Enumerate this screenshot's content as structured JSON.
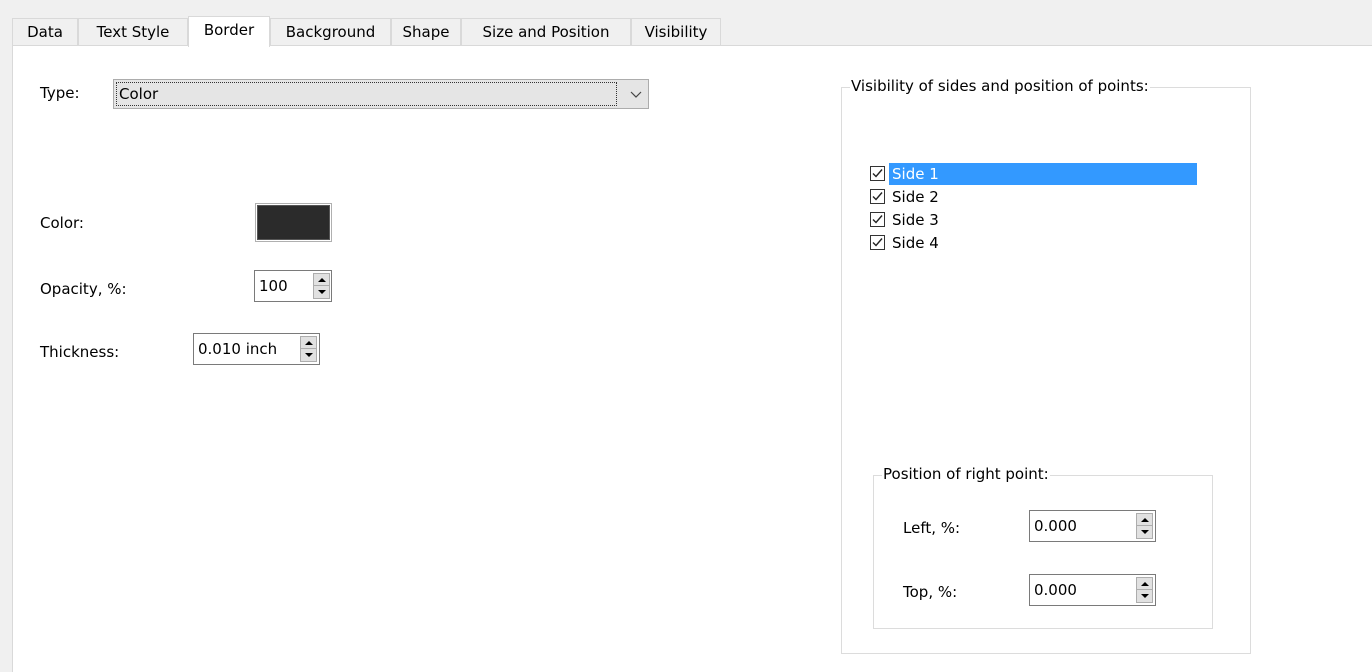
{
  "tabs": [
    {
      "label": "Data",
      "active": false
    },
    {
      "label": "Text Style",
      "active": false
    },
    {
      "label": "Border",
      "active": true
    },
    {
      "label": "Background",
      "active": false
    },
    {
      "label": "Shape",
      "active": false
    },
    {
      "label": "Size and Position",
      "active": false
    },
    {
      "label": "Visibility",
      "active": false
    }
  ],
  "border": {
    "type_label": "Type:",
    "type_value": "Color",
    "color_label": "Color:",
    "color_value": "#2b2b2b",
    "opacity_label": "Opacity, %:",
    "opacity_value": "100",
    "thickness_label": "Thickness:",
    "thickness_value": "0.010 inch"
  },
  "sides_group": {
    "title": "Visibility of sides and position of points:",
    "items": [
      {
        "label": "Side 1",
        "checked": true,
        "selected": true
      },
      {
        "label": "Side 2",
        "checked": true,
        "selected": false
      },
      {
        "label": "Side 3",
        "checked": true,
        "selected": false
      },
      {
        "label": "Side 4",
        "checked": true,
        "selected": false
      }
    ]
  },
  "right_point_group": {
    "title": "Position of right point:",
    "left_label": "Left, %:",
    "left_value": "0.000",
    "top_label": "Top, %:",
    "top_value": "0.000"
  },
  "colors": {
    "selection": "#3399ff",
    "panel_bg": "#ffffff",
    "window_bg": "#f0f0f0"
  }
}
